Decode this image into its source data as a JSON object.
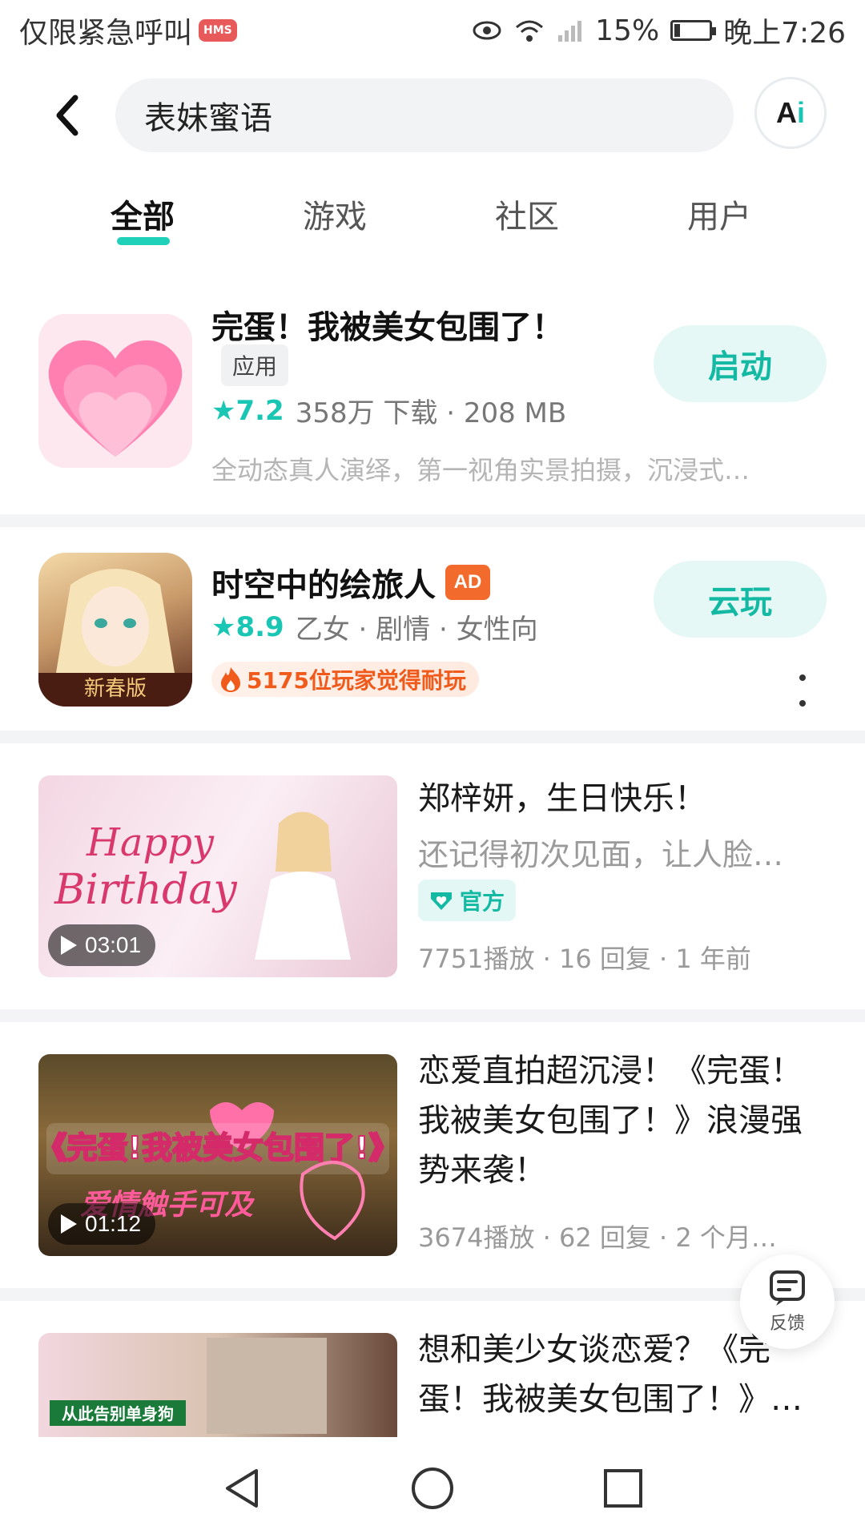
{
  "status_bar": {
    "carrier": "仅限紧急呼叫",
    "hms": "HMS",
    "battery": "15%",
    "time": "晚上7:26",
    "battery_level": 0.15
  },
  "search": {
    "query": "表妹蜜语",
    "ai_label_a": "A",
    "ai_label_i": "i"
  },
  "tabs": [
    {
      "label": "全部",
      "active": true
    },
    {
      "label": "游戏",
      "active": false
    },
    {
      "label": "社区",
      "active": false
    },
    {
      "label": "用户",
      "active": false
    }
  ],
  "results": {
    "app1": {
      "title": "完蛋！我被美女包围了！",
      "tag": "应用",
      "rating": "7.2",
      "meta": "358万 下载 · 208 MB",
      "desc": "全动态真人演绎，第一视角实景拍摄，沉浸式…",
      "action": "启动"
    },
    "app2": {
      "title": "时空中的绘旅人",
      "ad": "AD",
      "rating": "8.9",
      "meta": "乙女 · 剧情 · 女性向",
      "heat": "5175位玩家觉得耐玩",
      "action": "云玩"
    },
    "video1": {
      "title": "郑梓妍，生日快乐！",
      "subtitle": "还记得初次见面，让人脸…",
      "badge": "官方",
      "stats": "7751播放 · 16 回复 · 1 年前",
      "duration": "03:01"
    },
    "video2": {
      "title": "恋爱直拍超沉浸！《完蛋！我被美女包围了！》浪漫强势来袭！",
      "stats": "3674播放 · 62 回复 · 2 个月…",
      "duration": "01:12"
    },
    "video3": {
      "title": "想和美少女谈恋爱？《完蛋！我被美女包围了！》…"
    }
  },
  "feedback": {
    "label": "反馈"
  },
  "colors": {
    "accent": "#19c6b3",
    "accent_bg": "#e6f8f5",
    "ad": "#f26b2d",
    "heat": "#f05a1a"
  }
}
